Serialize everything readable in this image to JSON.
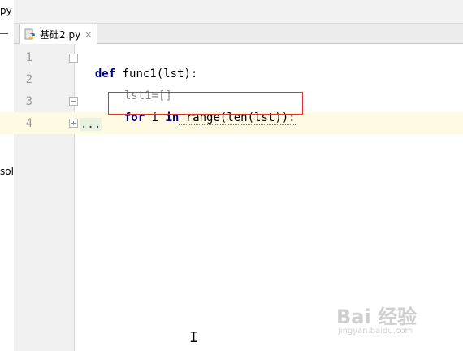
{
  "left_panel": {
    "top_text": "py",
    "mid_text": "sol"
  },
  "tab": {
    "title": "基础2.py",
    "close": "×"
  },
  "line_numbers": [
    "1",
    "2",
    "3",
    "4"
  ],
  "code": {
    "line1": {
      "kw": "def",
      "rest": " func1(lst):"
    },
    "line2": {
      "text": "lst1=[]"
    },
    "line3": {
      "kw1": "for",
      "mid1": " i ",
      "kw2": "in",
      "mid2": " range(len(lst)):"
    },
    "line4": {
      "folded": "..."
    }
  },
  "watermark": {
    "main": "Bai 经验",
    "sub": "jingyan.baidu.com"
  },
  "cursor_glyph": "I"
}
